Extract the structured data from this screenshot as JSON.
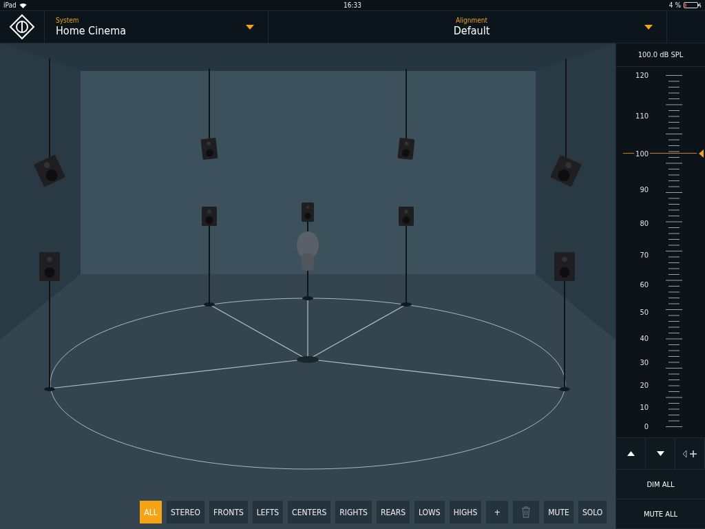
{
  "status_bar": {
    "device": "iPad",
    "time": "16:33",
    "battery": "4 %"
  },
  "header": {
    "system": {
      "label": "System",
      "value": "Home Cinema"
    },
    "alignment": {
      "label": "Alignment",
      "value": "Default"
    }
  },
  "meter": {
    "reading": "100.0 dB SPL",
    "scale": [
      "120",
      "110",
      "100",
      "90",
      "80",
      "70",
      "60",
      "50",
      "40",
      "30",
      "20",
      "10",
      "0"
    ],
    "level": 0.776
  },
  "meter_buttons": [
    "DIM ALL",
    "MUTE ALL"
  ],
  "toolbar": [
    {
      "kind": "label",
      "label": "ALL",
      "selected": true
    },
    {
      "kind": "label",
      "label": "STEREO",
      "selected": false
    },
    {
      "kind": "label",
      "label": "FRONTS",
      "selected": false
    },
    {
      "kind": "label",
      "label": "LEFTS",
      "selected": false
    },
    {
      "kind": "label",
      "label": "CENTERS",
      "selected": false
    },
    {
      "kind": "label",
      "label": "RIGHTS",
      "selected": false
    },
    {
      "kind": "label",
      "label": "REARS",
      "selected": false
    },
    {
      "kind": "label",
      "label": "LOWS",
      "selected": false
    },
    {
      "kind": "label",
      "label": "HIGHS",
      "selected": false
    },
    {
      "kind": "label",
      "label": "+",
      "selected": false
    },
    {
      "kind": "trash",
      "disabled": true
    },
    {
      "kind": "label",
      "label": "MUTE",
      "selected": false
    },
    {
      "kind": "label",
      "label": "SOLO",
      "selected": false
    }
  ]
}
